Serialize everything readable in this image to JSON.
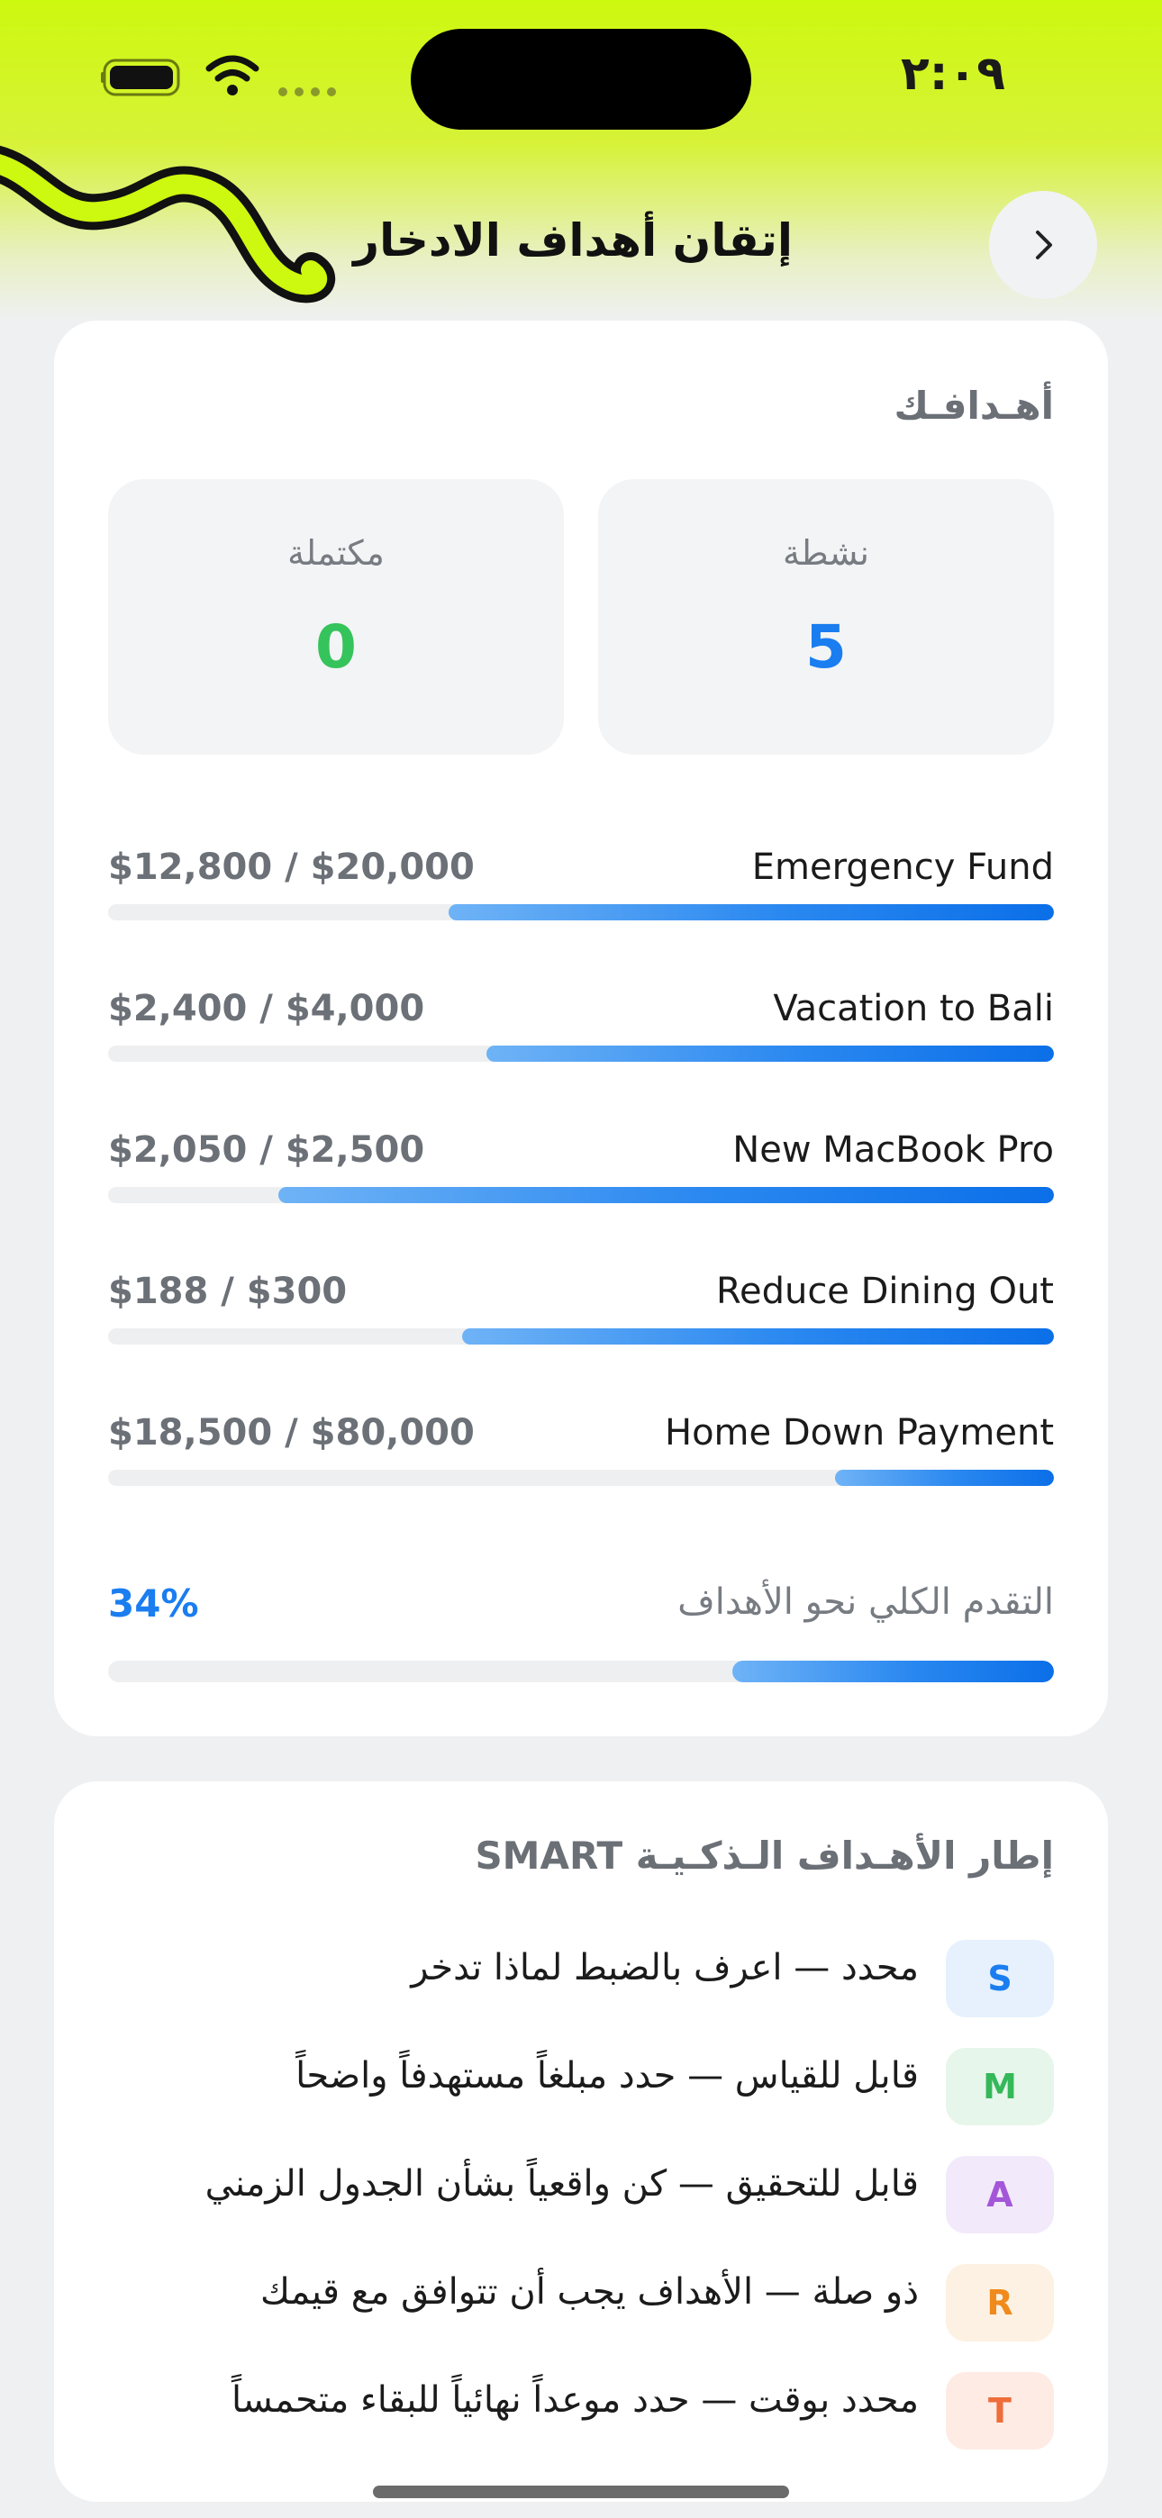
{
  "status_bar": {
    "time": "٢:٠٩"
  },
  "header": {
    "title": "إتقان أهداف الادخار"
  },
  "goals": {
    "title": "أهـدافـك",
    "stats": {
      "active_label": "نشطة",
      "active_value": "5",
      "completed_label": "مكتملة",
      "completed_value": "0"
    },
    "items": [
      {
        "name": "Emergency Fund",
        "amount": "$12,800 / $20,000",
        "progress": 0.64
      },
      {
        "name": "Vacation to Bali",
        "amount": "$2,400 / $4,000",
        "progress": 0.6
      },
      {
        "name": "New MacBook Pro",
        "amount": "$2,050 / $2,500",
        "progress": 0.82
      },
      {
        "name": "Reduce Dining Out",
        "amount": "$188 / $300",
        "progress": 0.626
      },
      {
        "name": "Home Down Payment",
        "amount": "$18,500 / $80,000",
        "progress": 0.231
      }
    ],
    "overall": {
      "label": "التقدم الكلي نحو الأهداف",
      "percent": "34%",
      "progress": 0.34
    }
  },
  "smart": {
    "title": "إطار الأهـداف الـذكـيـة SMART",
    "items": [
      {
        "letter": "S",
        "text": "محدد — اعرف بالضبط لماذا تدخر",
        "color": "#1a7df0",
        "bg": "#e6f1fd"
      },
      {
        "letter": "M",
        "text": "قابل للقياس — حدد مبلغاً مستهدفاً واضحاً",
        "color": "#35b85a",
        "bg": "#e6f6ea"
      },
      {
        "letter": "A",
        "text": "قابل للتحقيق — كن واقعياً بشأن الجدول الزمني",
        "color": "#a456d8",
        "bg": "#f2e9fa"
      },
      {
        "letter": "R",
        "text": "ذو صلة — الأهداف يجب أن تتوافق مع قيمك",
        "color": "#f08a1c",
        "bg": "#fdf1e3"
      },
      {
        "letter": "T",
        "text": "محدد بوقت — حدد موعداً نهائياً للبقاء متحمساً",
        "color": "#ee6d3a",
        "bg": "#fdebe4"
      }
    ]
  },
  "colors": {
    "accent": "#1a7df0",
    "header_lime": "#cdf80f",
    "success": "#35c35c"
  }
}
